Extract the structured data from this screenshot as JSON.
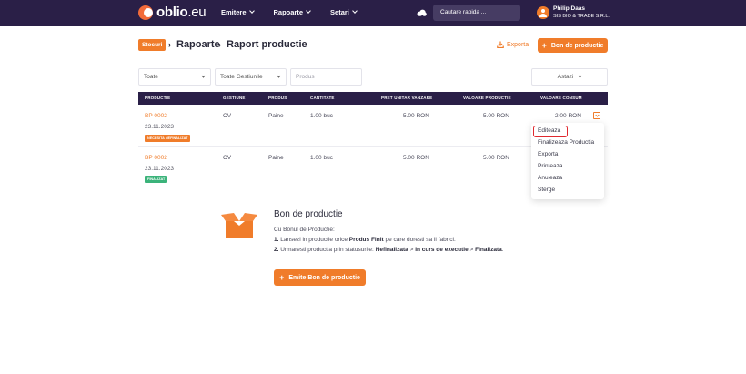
{
  "app": {
    "logo_main": "oblio",
    "logo_tld": ".eu",
    "nav": [
      "Emitere",
      "Rapoarte",
      "Setari"
    ],
    "search_placeholder": "Cautare rapida ...",
    "user_name": "Philip Daas",
    "user_company": "SIS BIO & TRADE S.R.L."
  },
  "header": {
    "badge": "Stocuri",
    "crumb1": "Rapoarte",
    "crumb2": "Raport productie",
    "export_label": "Exporta",
    "new_button": "Bon de productie",
    "separator": "›"
  },
  "filters": {
    "status": "Toate",
    "warehouse": "Toate Gestiunile",
    "product_placeholder": "Produs",
    "period": "Astazi"
  },
  "table": {
    "headers": [
      "PRODUCTIE",
      "GESTIUNE",
      "PRODUS",
      "CANTITATE",
      "PRET UNITAR VANZARE",
      "VALOARE PRODUCTIE",
      "VALOARE CONSUM"
    ],
    "rows": [
      {
        "doc": "BP 0002",
        "date": "23.11.2023",
        "status": "NECESITA NEFINALIZAT",
        "warehouse": "CV",
        "product": "Paine",
        "quantity": "1.00 buc",
        "unit_price": "5.00 RON",
        "production_value": "5.00 RON",
        "consumption_value": "2.00 RON"
      },
      {
        "doc": "BP 0002",
        "date": "23.11.2023",
        "status": "FINALIZAT",
        "warehouse": "CV",
        "product": "Paine",
        "quantity": "1.00 buc",
        "unit_price": "5.00 RON",
        "production_value": "5.00 RON",
        "consumption_value": ""
      }
    ]
  },
  "row_menu": [
    "Editeaza",
    "Finalizeaza Productia",
    "Exporta",
    "Printeaza",
    "Anuleaza",
    "Sterge"
  ],
  "info": {
    "title": "Bon de productie",
    "intro": "Cu Bonul de Productie:",
    "step1_prefix": "1.",
    "step1_text": " Lansezi in productie orice ",
    "step1_bold": "Produs Finit",
    "step1_suffix": " pe care doresti sa il fabrici.",
    "step2_prefix": "2.",
    "step2_text": " Urmaresti productia prin statusurile: ",
    "step2_s1": "Nefinalizata",
    "step2_arrow1": " > ",
    "step2_s2": "In curs de executie",
    "step2_arrow2": " > ",
    "step2_s3": "Finalizata",
    "step2_end": ".",
    "button": "Emite Bon de productie"
  },
  "colors": {
    "nav_bg": "#2a1f47",
    "accent": "#f07c2a",
    "status_green": "#3bb37a",
    "highlight": "#e0282e"
  }
}
